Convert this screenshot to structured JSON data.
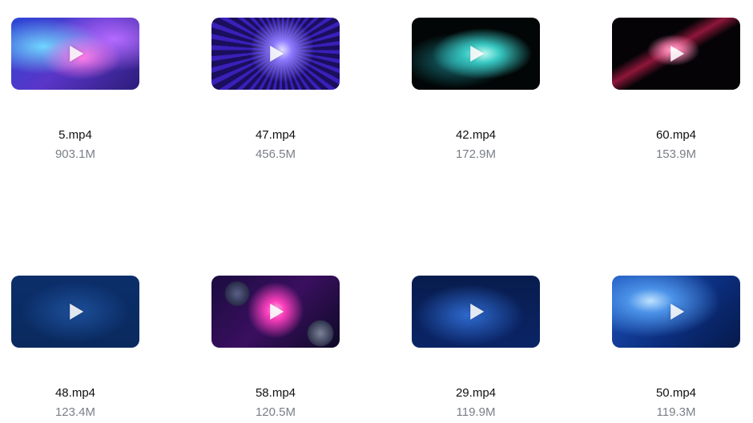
{
  "videos": [
    {
      "name": "5.mp4",
      "size": "903.1M",
      "thumb": "art1"
    },
    {
      "name": "47.mp4",
      "size": "456.5M",
      "thumb": "art2"
    },
    {
      "name": "42.mp4",
      "size": "172.9M",
      "thumb": "art3"
    },
    {
      "name": "60.mp4",
      "size": "153.9M",
      "thumb": "art4"
    },
    {
      "name": "48.mp4",
      "size": "123.4M",
      "thumb": "art5"
    },
    {
      "name": "58.mp4",
      "size": "120.5M",
      "thumb": "art6"
    },
    {
      "name": "29.mp4",
      "size": "119.9M",
      "thumb": "art7"
    },
    {
      "name": "50.mp4",
      "size": "119.3M",
      "thumb": "art8"
    }
  ],
  "icons": {
    "play": "play-icon"
  }
}
